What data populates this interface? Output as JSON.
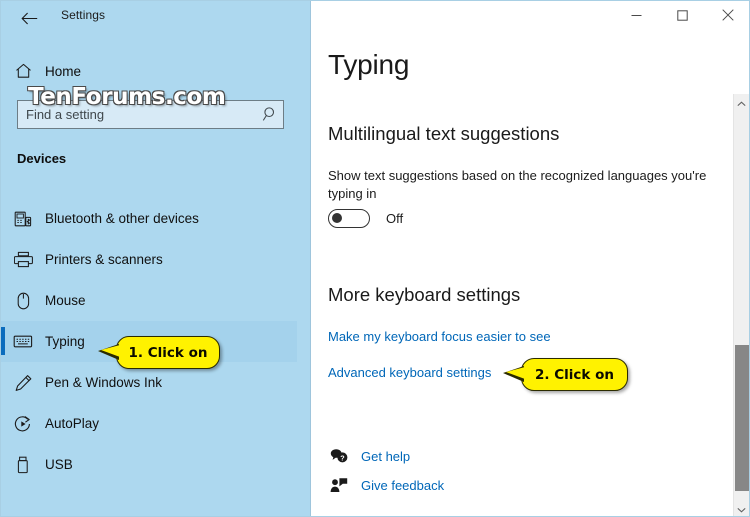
{
  "window": {
    "app_title": "Settings",
    "back_icon": "back-arrow-icon",
    "controls": {
      "minimize": "minimize-icon",
      "maximize": "maximize-icon",
      "close": "close-icon"
    }
  },
  "watermark": {
    "text": "TenForums.com"
  },
  "sidebar": {
    "home": {
      "label": "Home",
      "icon": "home-icon"
    },
    "search": {
      "placeholder": "Find a setting",
      "value": "",
      "icon": "search-icon"
    },
    "group_title": "Devices",
    "items": [
      {
        "label": "Bluetooth & other devices",
        "icon": "bluetooth-devices-icon",
        "selected": false
      },
      {
        "label": "Printers & scanners",
        "icon": "printer-icon",
        "selected": false
      },
      {
        "label": "Mouse",
        "icon": "mouse-icon",
        "selected": false
      },
      {
        "label": "Typing",
        "icon": "keyboard-icon",
        "selected": true
      },
      {
        "label": "Pen & Windows Ink",
        "icon": "pen-icon",
        "selected": false
      },
      {
        "label": "AutoPlay",
        "icon": "autoplay-icon",
        "selected": false
      },
      {
        "label": "USB",
        "icon": "usb-icon",
        "selected": false
      }
    ]
  },
  "main": {
    "page_title": "Typing",
    "sections": [
      {
        "heading": "Multilingual text suggestions",
        "description": "Show text suggestions based on the recognized languages you're typing in",
        "toggle": {
          "state": "Off",
          "checked": false
        }
      },
      {
        "heading": "More keyboard settings",
        "links": [
          "Make my keyboard focus easier to see",
          "Advanced keyboard settings"
        ]
      }
    ],
    "footer_links": [
      {
        "label": "Get help",
        "icon": "get-help-icon"
      },
      {
        "label": "Give feedback",
        "icon": "give-feedback-icon"
      }
    ]
  },
  "callouts": [
    {
      "text": "1. Click on"
    },
    {
      "text": "2. Click on"
    }
  ],
  "colors": {
    "sidebar_bg": "#add8ef",
    "accent": "#0b6cbd",
    "link": "#0067b8",
    "callout_bg": "#fff200",
    "scrollbar_thumb": "#878787"
  }
}
